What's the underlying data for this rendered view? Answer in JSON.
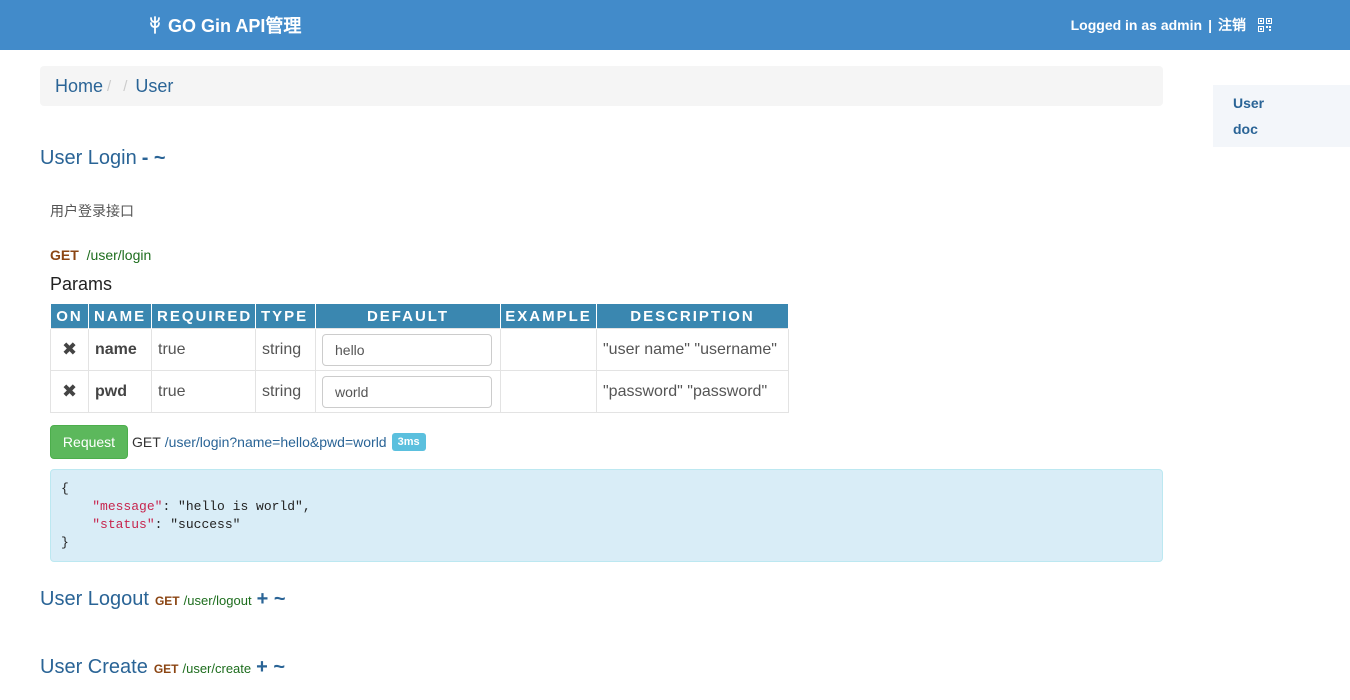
{
  "navbar": {
    "brand": "GO Gin API管理",
    "logged_in": "Logged in as admin",
    "separator": "|",
    "logout": "注销"
  },
  "breadcrumb": {
    "home": "Home",
    "sep1": "/",
    "sep2": "/",
    "current": "User"
  },
  "sidenav": {
    "items": [
      {
        "label": "User"
      },
      {
        "label": "doc"
      }
    ]
  },
  "sections": [
    {
      "title": "User Login",
      "toggle": "- ~"
    },
    {
      "title": "User Logout",
      "method": "GET",
      "path": "/user/logout",
      "toggle": "+ ~"
    },
    {
      "title": "User Create",
      "method": "GET",
      "path": "/user/create",
      "toggle": "+ ~"
    }
  ],
  "login": {
    "description": "用户登录接口",
    "method": "GET",
    "path": "/user/login",
    "params_heading": "Params",
    "columns": [
      "ON",
      "NAME",
      "REQUIRED",
      "TYPE",
      "DEFAULT",
      "EXAMPLE",
      "DESCRIPTION"
    ],
    "rows": [
      {
        "on": "✖",
        "name": "name",
        "required": "true",
        "type": "string",
        "default": "hello",
        "example": "",
        "description": "\"user name\" \"username\""
      },
      {
        "on": "✖",
        "name": "pwd",
        "required": "true",
        "type": "string",
        "default": "world",
        "example": "",
        "description": "\"password\" \"password\""
      }
    ],
    "request_button": "Request",
    "request_method": "GET",
    "request_url": "/user/login?name=hello&pwd=world",
    "timing": "3ms",
    "response": {
      "open": "{",
      "k1": "\"message\"",
      "v1": ": \"hello is world\",",
      "k2": "\"status\"",
      "v2": ": \"success\"",
      "close": "}"
    }
  },
  "colors": {
    "navbar": "#428bca",
    "link": "#2a6496",
    "table_header": "#3a87b0",
    "button": "#5cb85c",
    "badge": "#5bc0de",
    "response_bg": "#d9edf7"
  }
}
